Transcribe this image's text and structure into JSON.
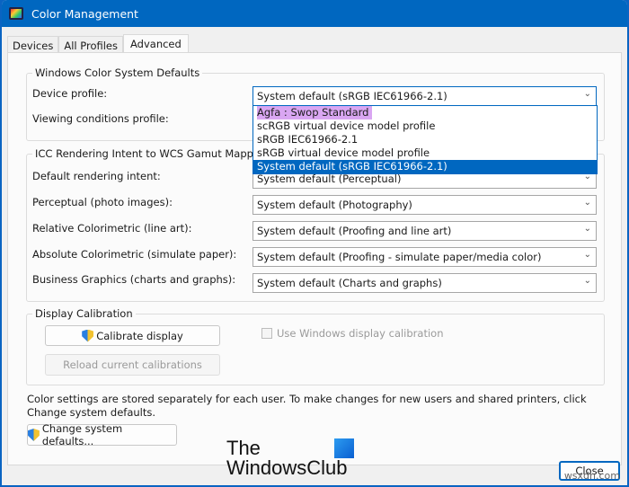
{
  "window": {
    "title": "Color Management"
  },
  "tabs": [
    {
      "label": "Devices"
    },
    {
      "label": "All Profiles"
    },
    {
      "label": "Advanced",
      "active": true
    }
  ],
  "wcs": {
    "title": "Windows Color System Defaults",
    "device_profile_label": "Device profile:",
    "device_profile_value": "System default (sRGB IEC61966-2.1)",
    "viewing_label": "Viewing conditions profile:",
    "dropdown_options": [
      "Agfa : Swop Standard",
      "scRGB virtual device model profile",
      "sRGB IEC61966-2.1",
      "sRGB virtual device model profile",
      "System default (sRGB IEC61966-2.1)"
    ],
    "highlighted": "Agfa : Swop Standard",
    "selected": "System default (sRGB IEC61966-2.1)"
  },
  "icc": {
    "title": "ICC Rendering Intent to WCS Gamut Mapping",
    "rows": [
      {
        "label": "Default rendering intent:",
        "value": "System default (Perceptual)"
      },
      {
        "label": "Perceptual (photo images):",
        "value": "System default (Photography)"
      },
      {
        "label": "Relative Colorimetric (line art):",
        "value": "System default (Proofing and line art)"
      },
      {
        "label": "Absolute Colorimetric (simulate paper):",
        "value": "System default (Proofing - simulate paper/media color)"
      },
      {
        "label": "Business Graphics (charts and graphs):",
        "value": "System default (Charts and graphs)"
      }
    ]
  },
  "calibration": {
    "title": "Display Calibration",
    "calibrate_label": "Calibrate display",
    "reload_label": "Reload current calibrations",
    "use_windows_label": "Use Windows display calibration",
    "use_windows_checked": false
  },
  "info_text": "Color settings are stored separately for each user. To make changes for new users and shared printers, click Change system defaults.",
  "change_defaults_label": "Change system defaults...",
  "close_label": "Close",
  "watermark": {
    "logo_line1": "The",
    "logo_line2": "WindowsClub",
    "site": "wsxdn.com"
  },
  "colors": {
    "accent": "#0067c0",
    "highlight": "#d9a6f2"
  }
}
